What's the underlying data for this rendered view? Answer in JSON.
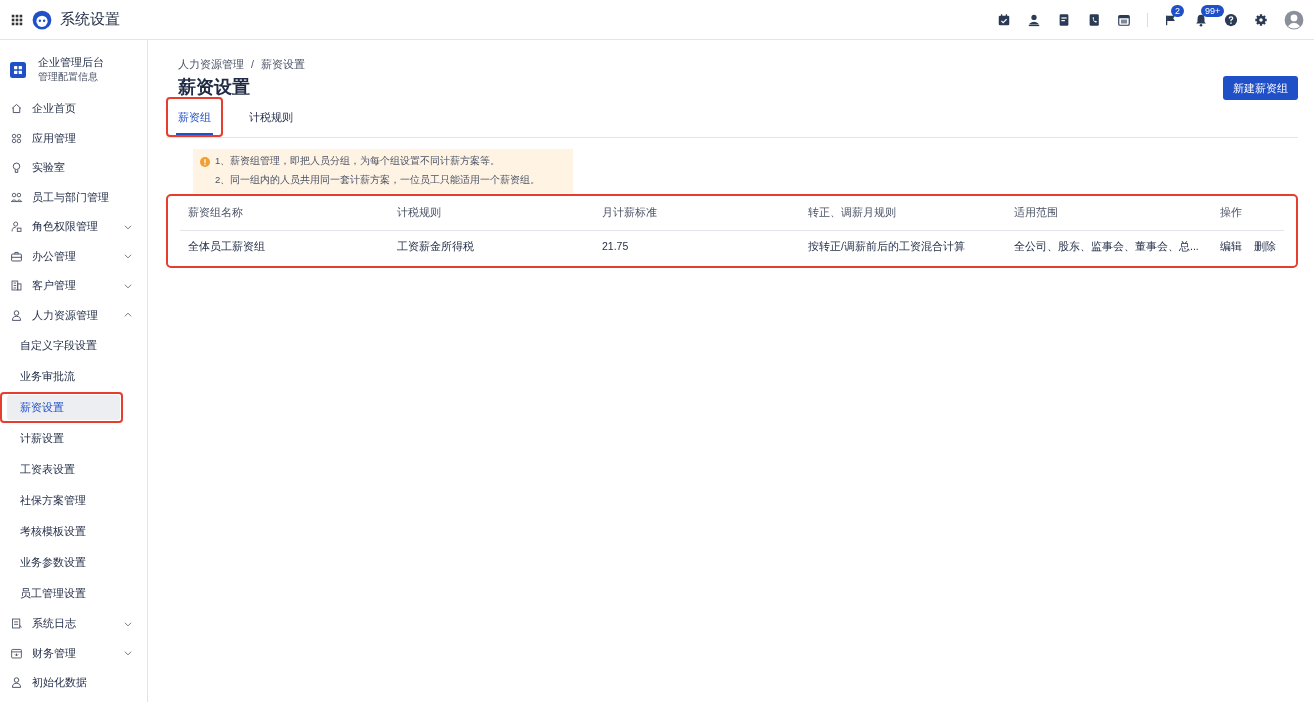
{
  "app": {
    "title": "系统设置"
  },
  "toolbar": {
    "items": [
      {
        "kind": "calendar-check"
      },
      {
        "kind": "person"
      },
      {
        "kind": "document"
      },
      {
        "kind": "phone-book"
      },
      {
        "kind": "calendar"
      },
      {
        "kind": "flag",
        "badge": "2"
      },
      {
        "kind": "bell",
        "badge": "99+"
      },
      {
        "kind": "help"
      },
      {
        "kind": "settings"
      },
      {
        "kind": "avatar"
      }
    ]
  },
  "sidebar": {
    "org_name": "企业管理后台",
    "org_subtitle": "管理配置信息",
    "items": [
      {
        "label": "企业首页",
        "kind": "home"
      },
      {
        "label": "应用管理",
        "kind": "apps"
      },
      {
        "label": "实验室",
        "kind": "bulb"
      },
      {
        "label": "员工与部门管理",
        "kind": "people"
      },
      {
        "label": "角色权限管理",
        "kind": "user-lock",
        "expanded": false
      },
      {
        "label": "办公管理",
        "kind": "briefcase",
        "expanded": false
      },
      {
        "label": "客户管理",
        "kind": "building",
        "expanded": false
      },
      {
        "label": "人力资源管理",
        "kind": "person",
        "expanded": true,
        "children": [
          {
            "label": "自定义字段设置",
            "selected": false,
            "highlighted": false
          },
          {
            "label": "业务审批流",
            "selected": false,
            "highlighted": false
          },
          {
            "label": "薪资设置",
            "selected": true,
            "highlighted": true
          },
          {
            "label": "计薪设置",
            "selected": false,
            "highlighted": false
          },
          {
            "label": "工资表设置",
            "selected": false,
            "highlighted": false
          },
          {
            "label": "社保方案管理",
            "selected": false,
            "highlighted": false
          },
          {
            "label": "考核模板设置",
            "selected": false,
            "highlighted": false
          },
          {
            "label": "业务参数设置",
            "selected": false,
            "highlighted": false
          },
          {
            "label": "员工管理设置",
            "selected": false,
            "highlighted": false
          }
        ]
      },
      {
        "label": "系统日志",
        "kind": "log",
        "expanded": false
      },
      {
        "label": "财务管理",
        "kind": "wallet",
        "expanded": false
      },
      {
        "label": "初始化数据",
        "kind": "person"
      }
    ]
  },
  "breadcrumb": [
    "人力资源管理",
    "/",
    "薪资设置"
  ],
  "page_title": "薪资设置",
  "primary_button": "新建薪资组",
  "tabs": [
    {
      "label": "薪资组",
      "selected": true,
      "highlighted": true
    },
    {
      "label": "计税规则",
      "selected": false,
      "highlighted": false
    }
  ],
  "notice": [
    "1、薪资组管理，即把人员分组，为每个组设置不同计薪方案等。",
    "2、同一组内的人员共用同一套计薪方案，一位员工只能适用一个薪资组。"
  ],
  "table": {
    "highlighted": true,
    "columns": [
      "薪资组名称",
      "计税规则",
      "月计薪标准",
      "转正、调薪月规则",
      "适用范围",
      "操作"
    ],
    "rows": [
      {
        "cells": [
          "全体员工薪资组",
          "工资薪金所得税",
          "21.75",
          "按转正/调薪前后的工资混合计算",
          "全公司、股东、监事会、董事会、总..."
        ],
        "actions": [
          "编辑",
          "删除"
        ]
      }
    ]
  }
}
